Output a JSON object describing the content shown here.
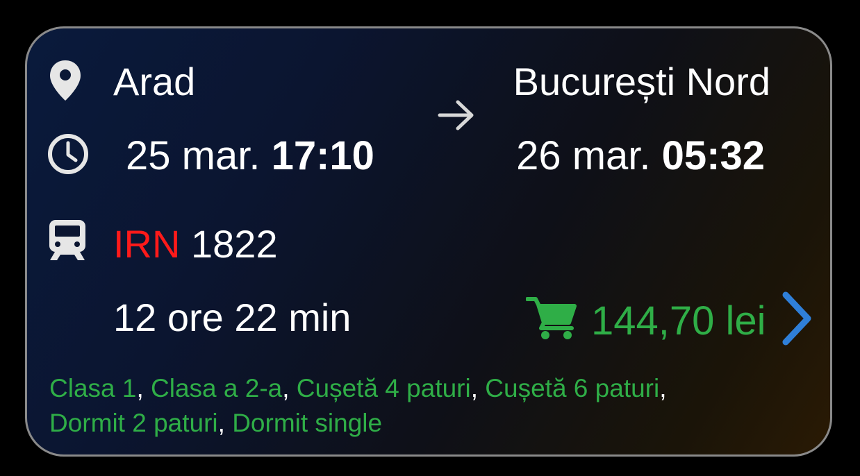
{
  "route": {
    "origin": "Arad",
    "destination": "București Nord"
  },
  "departure": {
    "date": "25 mar.",
    "time": "17:10"
  },
  "arrival": {
    "date": "26 mar.",
    "time": "05:32"
  },
  "train": {
    "category": "IRN",
    "number": "1822"
  },
  "duration": "12 ore 22 min",
  "price": "144,70 lei",
  "classes": [
    "Clasa 1",
    "Clasa a 2-a",
    "Cușetă 4 paturi",
    "Cușetă 6 paturi",
    "Dormit 2 paturi",
    "Dormit single"
  ],
  "colors": {
    "accent_green": "#2fae47",
    "train_category_red": "#ff1a1a",
    "chevron_blue": "#2f7fd8",
    "card_border": "#8a8a8a"
  },
  "icons": {
    "origin": "location-pin-icon",
    "time": "clock-icon",
    "train": "train-icon",
    "direction": "arrow-right-icon",
    "cart": "shopping-cart-icon",
    "open": "chevron-right-icon"
  }
}
